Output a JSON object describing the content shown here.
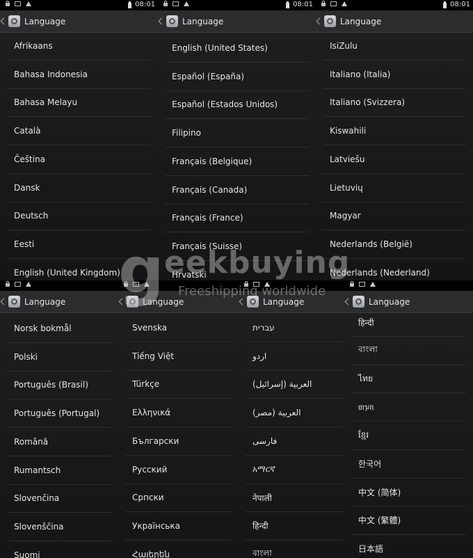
{
  "status": {
    "time": "08:01"
  },
  "action_bar": {
    "title": "Language"
  },
  "panels": [
    {
      "items": [
        "Afrikaans",
        "Bahasa Indonesia",
        "Bahasa Melayu",
        "Català",
        "Čeština",
        "Dansk",
        "Deutsch",
        "Eesti",
        "English (United Kingdom)"
      ]
    },
    {
      "items": [
        "English (United States)",
        "Español (España)",
        "Español (Estados Unidos)",
        "Filipino",
        "Français (Belgique)",
        "Français (Canada)",
        "Français (France)",
        "Français (Suisse)",
        "Hrvatski"
      ]
    },
    {
      "items": [
        "IsiZulu",
        "Italiano (Italia)",
        "Italiano (Svizzera)",
        "Kiswahili",
        "Latviešu",
        "Lietuvių",
        "Magyar",
        "Nederlands (België)",
        "Nederlands (Nederland)"
      ]
    },
    {
      "items": [
        "Norsk bokmål",
        "Polski",
        "Português (Brasil)",
        "Português (Portugal)",
        "Română",
        "Rumantsch",
        "Slovenčina",
        "Slovenščina",
        "Suomi"
      ]
    },
    {
      "items": [
        "Svenska",
        "Tiếng Việt",
        "Türkçe",
        "Ελληνικά",
        "Български",
        "Русский",
        "Српски",
        "Українська",
        "Հայերեն"
      ]
    },
    {
      "items": [
        "עברית",
        "اردو",
        "العربية (إسرائيل)",
        "العربية (مصر)",
        "فارسی",
        "አማርኛ",
        "नेपाली",
        "हिन्दी",
        "বাংলা"
      ]
    },
    {
      "items": [
        "हिन्दी",
        "বাংলা",
        "ไทย",
        "ᥖᥭᥰ",
        "ខ្មែរ",
        "한국어",
        "中文 (简体)",
        "中文 (繁體)",
        "日本語"
      ]
    }
  ],
  "watermark": {
    "brand": "eekbuying",
    "logo_letter": "g",
    "tagline": "Freeshipping worldwide"
  }
}
